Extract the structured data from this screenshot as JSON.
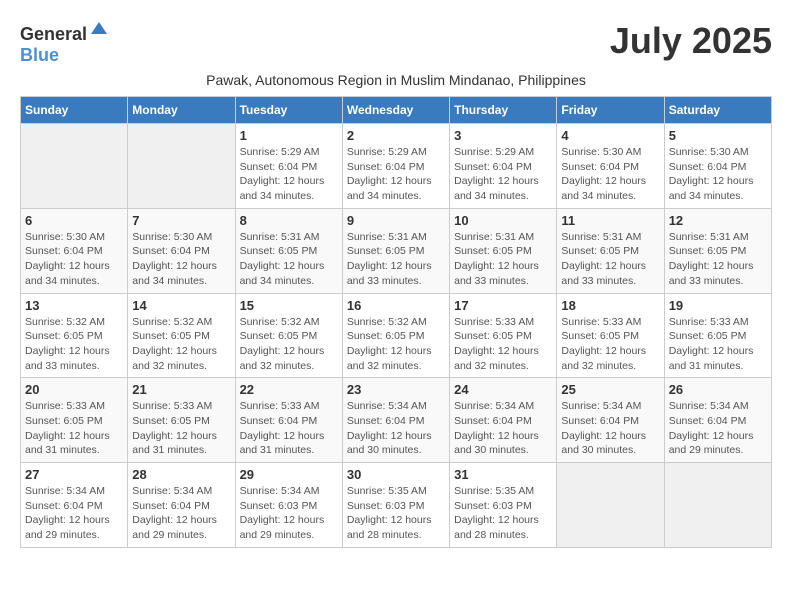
{
  "header": {
    "logo_general": "General",
    "logo_blue": "Blue",
    "month_title": "July 2025",
    "subtitle": "Pawak, Autonomous Region in Muslim Mindanao, Philippines"
  },
  "columns": [
    "Sunday",
    "Monday",
    "Tuesday",
    "Wednesday",
    "Thursday",
    "Friday",
    "Saturday"
  ],
  "weeks": [
    {
      "days": [
        {
          "num": "",
          "info": ""
        },
        {
          "num": "",
          "info": ""
        },
        {
          "num": "1",
          "info": "Sunrise: 5:29 AM\nSunset: 6:04 PM\nDaylight: 12 hours and 34 minutes."
        },
        {
          "num": "2",
          "info": "Sunrise: 5:29 AM\nSunset: 6:04 PM\nDaylight: 12 hours and 34 minutes."
        },
        {
          "num": "3",
          "info": "Sunrise: 5:29 AM\nSunset: 6:04 PM\nDaylight: 12 hours and 34 minutes."
        },
        {
          "num": "4",
          "info": "Sunrise: 5:30 AM\nSunset: 6:04 PM\nDaylight: 12 hours and 34 minutes."
        },
        {
          "num": "5",
          "info": "Sunrise: 5:30 AM\nSunset: 6:04 PM\nDaylight: 12 hours and 34 minutes."
        }
      ]
    },
    {
      "days": [
        {
          "num": "6",
          "info": "Sunrise: 5:30 AM\nSunset: 6:04 PM\nDaylight: 12 hours and 34 minutes."
        },
        {
          "num": "7",
          "info": "Sunrise: 5:30 AM\nSunset: 6:04 PM\nDaylight: 12 hours and 34 minutes."
        },
        {
          "num": "8",
          "info": "Sunrise: 5:31 AM\nSunset: 6:05 PM\nDaylight: 12 hours and 34 minutes."
        },
        {
          "num": "9",
          "info": "Sunrise: 5:31 AM\nSunset: 6:05 PM\nDaylight: 12 hours and 33 minutes."
        },
        {
          "num": "10",
          "info": "Sunrise: 5:31 AM\nSunset: 6:05 PM\nDaylight: 12 hours and 33 minutes."
        },
        {
          "num": "11",
          "info": "Sunrise: 5:31 AM\nSunset: 6:05 PM\nDaylight: 12 hours and 33 minutes."
        },
        {
          "num": "12",
          "info": "Sunrise: 5:31 AM\nSunset: 6:05 PM\nDaylight: 12 hours and 33 minutes."
        }
      ]
    },
    {
      "days": [
        {
          "num": "13",
          "info": "Sunrise: 5:32 AM\nSunset: 6:05 PM\nDaylight: 12 hours and 33 minutes."
        },
        {
          "num": "14",
          "info": "Sunrise: 5:32 AM\nSunset: 6:05 PM\nDaylight: 12 hours and 32 minutes."
        },
        {
          "num": "15",
          "info": "Sunrise: 5:32 AM\nSunset: 6:05 PM\nDaylight: 12 hours and 32 minutes."
        },
        {
          "num": "16",
          "info": "Sunrise: 5:32 AM\nSunset: 6:05 PM\nDaylight: 12 hours and 32 minutes."
        },
        {
          "num": "17",
          "info": "Sunrise: 5:33 AM\nSunset: 6:05 PM\nDaylight: 12 hours and 32 minutes."
        },
        {
          "num": "18",
          "info": "Sunrise: 5:33 AM\nSunset: 6:05 PM\nDaylight: 12 hours and 32 minutes."
        },
        {
          "num": "19",
          "info": "Sunrise: 5:33 AM\nSunset: 6:05 PM\nDaylight: 12 hours and 31 minutes."
        }
      ]
    },
    {
      "days": [
        {
          "num": "20",
          "info": "Sunrise: 5:33 AM\nSunset: 6:05 PM\nDaylight: 12 hours and 31 minutes."
        },
        {
          "num": "21",
          "info": "Sunrise: 5:33 AM\nSunset: 6:05 PM\nDaylight: 12 hours and 31 minutes."
        },
        {
          "num": "22",
          "info": "Sunrise: 5:33 AM\nSunset: 6:04 PM\nDaylight: 12 hours and 31 minutes."
        },
        {
          "num": "23",
          "info": "Sunrise: 5:34 AM\nSunset: 6:04 PM\nDaylight: 12 hours and 30 minutes."
        },
        {
          "num": "24",
          "info": "Sunrise: 5:34 AM\nSunset: 6:04 PM\nDaylight: 12 hours and 30 minutes."
        },
        {
          "num": "25",
          "info": "Sunrise: 5:34 AM\nSunset: 6:04 PM\nDaylight: 12 hours and 30 minutes."
        },
        {
          "num": "26",
          "info": "Sunrise: 5:34 AM\nSunset: 6:04 PM\nDaylight: 12 hours and 29 minutes."
        }
      ]
    },
    {
      "days": [
        {
          "num": "27",
          "info": "Sunrise: 5:34 AM\nSunset: 6:04 PM\nDaylight: 12 hours and 29 minutes."
        },
        {
          "num": "28",
          "info": "Sunrise: 5:34 AM\nSunset: 6:04 PM\nDaylight: 12 hours and 29 minutes."
        },
        {
          "num": "29",
          "info": "Sunrise: 5:34 AM\nSunset: 6:03 PM\nDaylight: 12 hours and 29 minutes."
        },
        {
          "num": "30",
          "info": "Sunrise: 5:35 AM\nSunset: 6:03 PM\nDaylight: 12 hours and 28 minutes."
        },
        {
          "num": "31",
          "info": "Sunrise: 5:35 AM\nSunset: 6:03 PM\nDaylight: 12 hours and 28 minutes."
        },
        {
          "num": "",
          "info": ""
        },
        {
          "num": "",
          "info": ""
        }
      ]
    }
  ]
}
